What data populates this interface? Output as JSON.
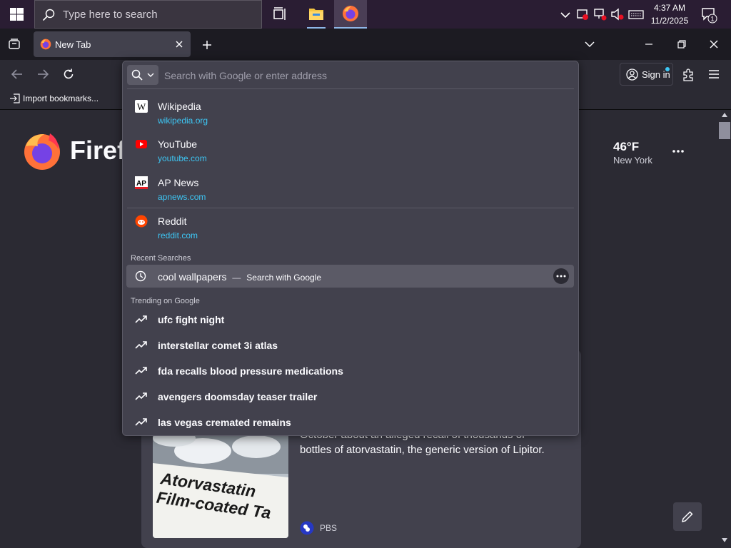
{
  "taskbar": {
    "search_placeholder": "Type here to search",
    "clock": {
      "time": "4:37 AM",
      "date": "11/2/2025"
    },
    "notification_count": "1"
  },
  "browser": {
    "tab_title": "New Tab",
    "bookmarks_import": "Import bookmarks...",
    "sign_in": "Sign in"
  },
  "urlbar": {
    "placeholder": "Search with Google or enter address",
    "sites": [
      {
        "title": "Wikipedia",
        "url": "wikipedia.org"
      },
      {
        "title": "YouTube",
        "url": "youtube.com"
      },
      {
        "title": "AP News",
        "url": "apnews.com"
      },
      {
        "title": "Reddit",
        "url": "reddit.com"
      }
    ],
    "recent_label": "Recent Searches",
    "recent": {
      "query": "cool wallpapers",
      "separator": "—",
      "action": "Search with Google"
    },
    "trending_label": "Trending on Google",
    "trending": [
      "ufc fight night",
      "interstellar comet 3i atlas",
      "fda recalls blood pressure medications",
      "avengers doomsday teaser trailer",
      "las vegas cremated remains"
    ]
  },
  "page": {
    "brand": "Firefox",
    "weather": {
      "temp": "46°F",
      "city": "New York"
    },
    "story": {
      "text_line1": "October about an alleged recall of thousands of",
      "text_line2": "bottles of atorvastatin, the generic version of Lipitor.",
      "source": "PBS",
      "image_text": "Atorvastatin Film-coated Ta"
    }
  },
  "colors": {
    "accent_link": "#3dc7f5",
    "panel": "#42414d",
    "chrome": "#2b2a33",
    "taskbar": "#2a1d33"
  }
}
